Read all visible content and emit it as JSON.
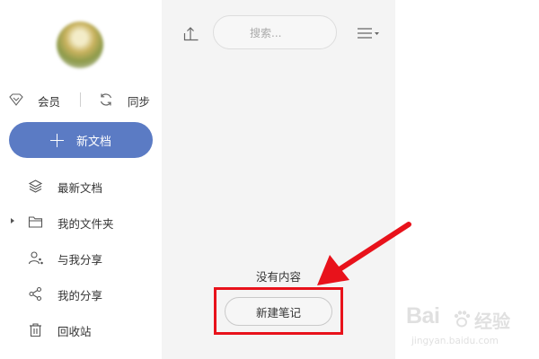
{
  "sidebar": {
    "top_actions": {
      "vip_label": "会员",
      "sync_label": "同步"
    },
    "new_doc_label": "新文档",
    "items": [
      {
        "label": "最新文档",
        "icon": "layers-icon"
      },
      {
        "label": "我的文件夹",
        "icon": "folder-icon",
        "expandable": true
      },
      {
        "label": "与我分享",
        "icon": "shared-with-me-icon"
      },
      {
        "label": "我的分享",
        "icon": "share-icon"
      },
      {
        "label": "回收站",
        "icon": "trash-icon"
      }
    ]
  },
  "list": {
    "search_placeholder": "搜索...",
    "empty_text": "没有内容",
    "new_note_label": "新建笔记"
  },
  "colors": {
    "accent": "#5b7bc4",
    "annotation": "#e8121b",
    "list_background": "#f4f4f4"
  },
  "watermark": {
    "logo": "Bai",
    "cn": "经验",
    "url": "jingyan.baidu.com"
  }
}
